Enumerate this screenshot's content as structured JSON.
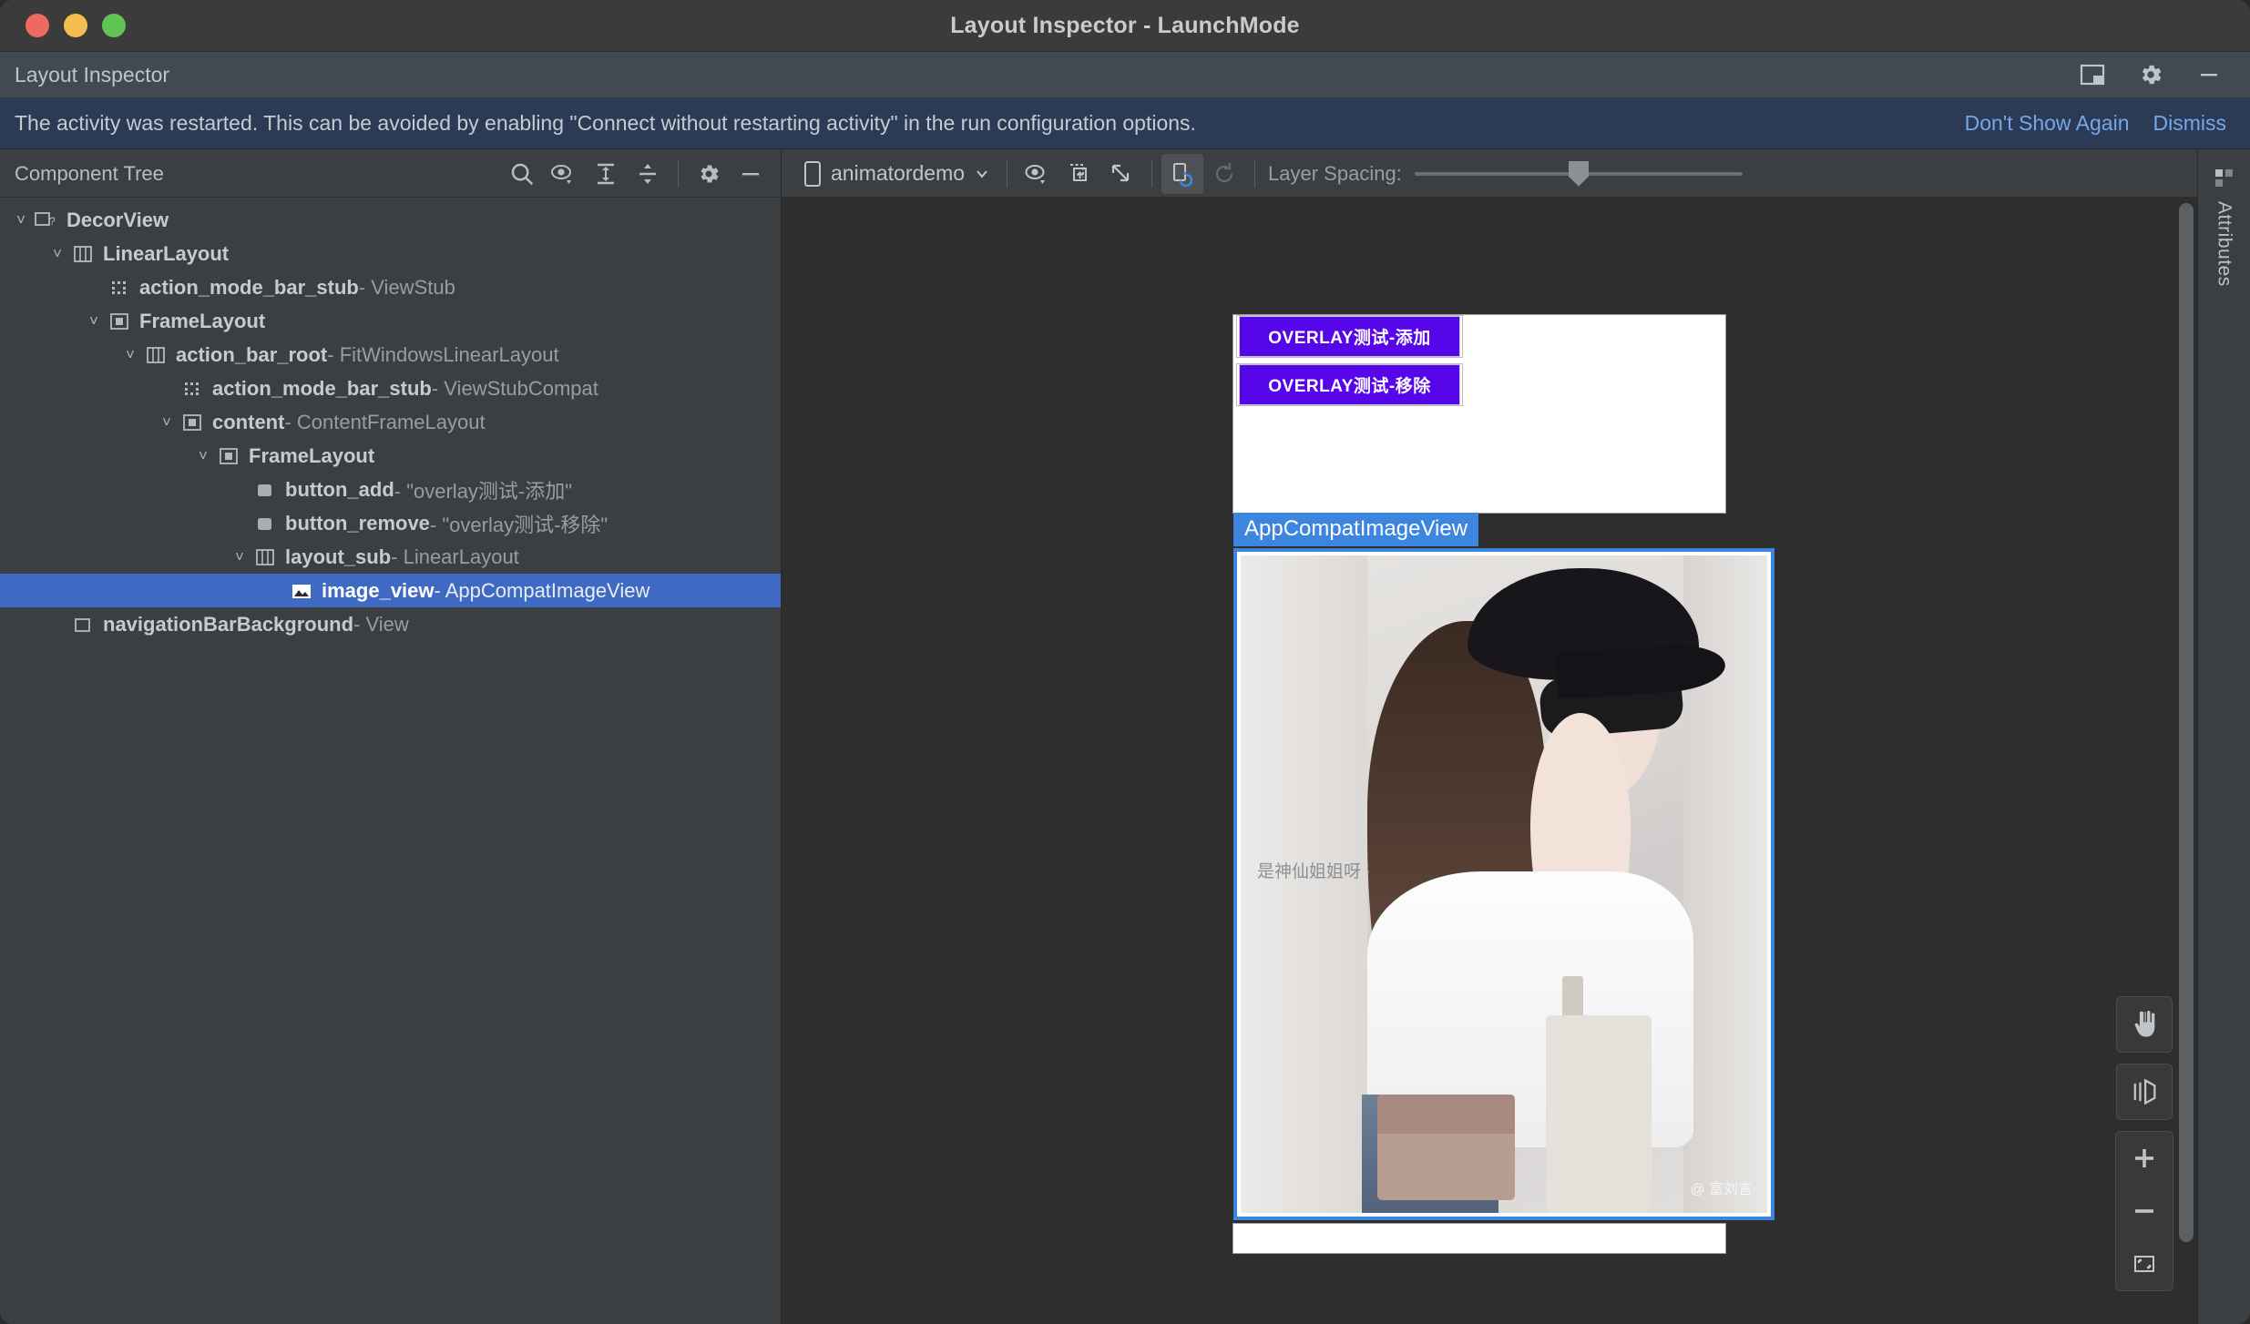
{
  "window": {
    "title": "Layout Inspector - LaunchMode",
    "traffic_lights": [
      "close",
      "minimize",
      "maximize"
    ]
  },
  "tool_window": {
    "title": "Layout Inspector",
    "actions": [
      {
        "name": "layout-settings-icon",
        "label": "Layout Settings"
      },
      {
        "name": "gear-icon",
        "label": "Settings"
      },
      {
        "name": "minimize-icon",
        "label": "Minimize"
      }
    ]
  },
  "banner": {
    "message": "The activity was restarted. This can be avoided by enabling \"Connect without restarting activity\" in the run configuration options.",
    "dont_show_again": "Don't Show Again",
    "dismiss": "Dismiss",
    "link_color": "#77a7e8",
    "background": "#2b3a55"
  },
  "tree_toolbar": {
    "title": "Component Tree",
    "buttons": [
      {
        "name": "search-icon",
        "label": "Search"
      },
      {
        "name": "filter-eye-icon",
        "label": "View Options"
      },
      {
        "name": "expand-all-icon",
        "label": "Expand All"
      },
      {
        "name": "collapse-all-icon",
        "label": "Collapse All"
      },
      {
        "name": "gear-icon",
        "label": "Settings"
      },
      {
        "name": "minimize-icon",
        "label": "Hide"
      }
    ]
  },
  "view_toolbar": {
    "device": "animatordemo",
    "device_icon": "phone-icon",
    "buttons": [
      {
        "name": "view-options-icon",
        "label": "View Options"
      },
      {
        "name": "overlay-icon",
        "label": "Load Overlay"
      },
      {
        "name": "snapshot-icon",
        "label": "Export Snapshot"
      },
      {
        "name": "live-updates-icon",
        "label": "Live Updates",
        "active": true
      },
      {
        "name": "refresh-icon",
        "label": "Refresh",
        "disabled": true
      }
    ],
    "layer_spacing_label": "Layer Spacing:",
    "layer_spacing_value": 47
  },
  "component_tree": {
    "selected_id": "image_view",
    "selected_color": "#3f6ac4",
    "rows": [
      {
        "depth": 0,
        "arrow": "˅",
        "icon": "decorview-icon",
        "name": "DecorView",
        "sub": "",
        "selected": false,
        "guide": ""
      },
      {
        "depth": 1,
        "arrow": "˅",
        "icon": "linearlayout-icon",
        "name": "LinearLayout",
        "sub": "",
        "selected": false,
        "guide": "├─"
      },
      {
        "depth": 2,
        "arrow": "",
        "icon": "viewstub-icon",
        "name": "action_mode_bar_stub",
        "sub": " - ViewStub",
        "selected": false,
        "guide": "│  ├──"
      },
      {
        "depth": 2,
        "arrow": "˅",
        "icon": "framelayout-icon",
        "name": "FrameLayout",
        "sub": "",
        "selected": false,
        "guide": "│  └─"
      },
      {
        "depth": 3,
        "arrow": "˅",
        "icon": "linearlayout-icon",
        "name": "action_bar_root",
        "sub": " - FitWindowsLinearLayout",
        "selected": false,
        "guide": "│     "
      },
      {
        "depth": 4,
        "arrow": "",
        "icon": "viewstub-icon",
        "name": "action_mode_bar_stub",
        "sub": " - ViewStubCompat",
        "selected": false,
        "guide": "│       ├──"
      },
      {
        "depth": 4,
        "arrow": "˅",
        "icon": "framelayout-icon",
        "name": "content",
        "sub": " - ContentFrameLayout",
        "selected": false,
        "guide": "│       └─"
      },
      {
        "depth": 5,
        "arrow": "˅",
        "icon": "framelayout-icon",
        "name": "FrameLayout",
        "sub": "",
        "selected": false,
        "guide": "│          "
      },
      {
        "depth": 6,
        "arrow": "",
        "icon": "button-icon",
        "name": "button_add",
        "sub": " - \"overlay测试-添加\"",
        "selected": false,
        "guide": "│            ├──"
      },
      {
        "depth": 6,
        "arrow": "",
        "icon": "button-icon",
        "name": "button_remove",
        "sub": " - \"overlay测试-移除\"",
        "selected": false,
        "guide": "│            ├──"
      },
      {
        "depth": 6,
        "arrow": "˅",
        "icon": "linearlayout-icon",
        "name": "layout_sub",
        "sub": " - LinearLayout",
        "selected": false,
        "guide": "│            └─"
      },
      {
        "depth": 7,
        "arrow": "",
        "icon": "imageview-icon",
        "name": "image_view",
        "sub": " - AppCompatImageView",
        "selected": true,
        "guide": "│               "
      },
      {
        "depth": 1,
        "arrow": "",
        "icon": "view-icon",
        "name": "navigationBarBackground",
        "sub": " - View",
        "selected": false,
        "guide": "└──"
      }
    ]
  },
  "device_preview": {
    "selection_badge": "AppCompatImageView",
    "selection_color": "#3d86e0",
    "buttons": [
      {
        "name": "button-add",
        "label": "OVERLAY测试-添加",
        "color": "#5606e8",
        "text_color": "#ffffff"
      },
      {
        "name": "button-remove",
        "label": "OVERLAY测试-移除",
        "color": "#5606e8",
        "text_color": "#ffffff"
      }
    ],
    "image_watermark": "是神仙姐姐呀 ·",
    "image_watermark_corner": "@ 富刘言"
  },
  "zoom_controls": [
    {
      "name": "pan-hand-icon",
      "label": "Pan"
    },
    {
      "name": "rotate-3d-icon",
      "label": "3D Mode"
    },
    {
      "name": "zoom-in-icon",
      "label": "Zoom In"
    },
    {
      "name": "zoom-out-icon",
      "label": "Zoom Out"
    },
    {
      "name": "zoom-to-fit-icon",
      "label": "Zoom to Fit"
    }
  ],
  "attributes_panel": {
    "label": "Attributes",
    "icon": "attributes-icon"
  }
}
